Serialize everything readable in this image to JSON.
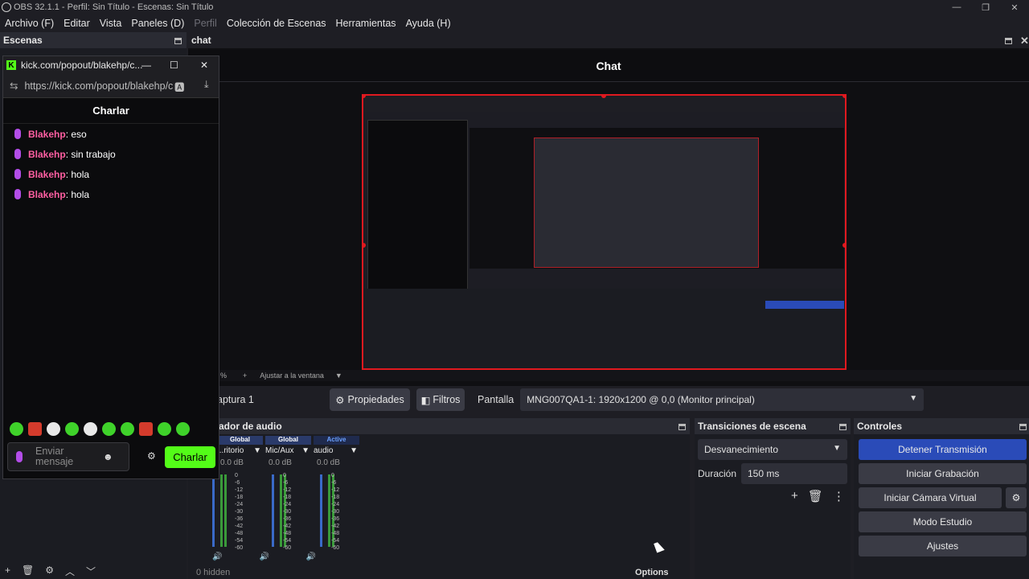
{
  "titlebar": {
    "title": "OBS 32.1.1 - Perfil: Sin Título - Escenas: Sin Título",
    "min": "—",
    "max": "❐",
    "close": "✕"
  },
  "menu": [
    "Archivo (F)",
    "Editar",
    "Vista",
    "Paneles (D)",
    "Perfil",
    "Colección de Escenas",
    "Herramientas",
    "Ayuda (H)"
  ],
  "scenes": {
    "title": "Escenas"
  },
  "chat_dock": {
    "title": "chat",
    "header": "Chat"
  },
  "kick": {
    "title": "kick.com/popout/blakehp/c...",
    "url": "https://kick.com/popout/blakehp/c",
    "chat_title": "Charlar",
    "messages": [
      {
        "user": "Blakehp",
        "text": ": eso"
      },
      {
        "user": "Blakehp",
        "text": ": sin trabajo"
      },
      {
        "user": "Blakehp",
        "text": ": hola"
      },
      {
        "user": "Blakehp",
        "text": ": hola"
      }
    ],
    "input_placeholder": "Enviar mensaje",
    "send": "Charlar",
    "accent": "#53fc18"
  },
  "zoom": {
    "value": "%",
    "fit": "Ajustar a la ventana"
  },
  "source_toolbar": {
    "source": "aptura 1",
    "properties": "Propiedades",
    "filters": "Filtros",
    "display_label": "Pantalla",
    "display_value": "MNG007QA1-1: 1920x1200 @ 0,0 (Monitor principal)"
  },
  "mixer": {
    "title": "ador de audio",
    "channels": [
      {
        "header": "Global",
        "name": "...ritorio",
        "db": "0.0 dB"
      },
      {
        "header": "Global",
        "name": "Mic/Aux",
        "db": "0.0 dB"
      },
      {
        "header": "Active",
        "name": "audio",
        "db": "0.0 dB"
      }
    ],
    "scale": [
      "0",
      "-6",
      "-12",
      "-18",
      "-24",
      "-30",
      "-36",
      "-42",
      "-48",
      "-54",
      "-60"
    ],
    "footer_hidden": "0 hidden",
    "footer_options": "Options"
  },
  "transitions": {
    "title": "Transiciones de escena",
    "type": "Desvanecimiento",
    "duration_label": "Duración",
    "duration": "150 ms"
  },
  "controls": {
    "title": "Controles",
    "buttons": [
      "Detener Transmisión",
      "Iniciar Grabación",
      "Iniciar Cámara Virtual",
      "Modo Estudio",
      "Ajustes"
    ],
    "accent": "#2a4bb8"
  }
}
